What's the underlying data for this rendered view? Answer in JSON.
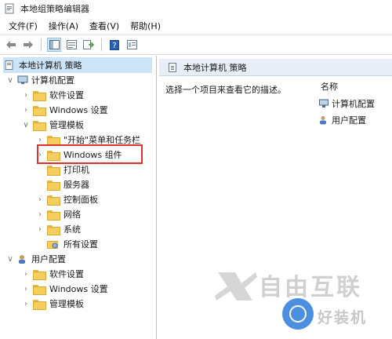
{
  "window": {
    "title": "本地组策略编辑器"
  },
  "menu": [
    "文件(F)",
    "操作(A)",
    "查看(V)",
    "帮助(H)"
  ],
  "toolbar": {
    "buttons": [
      "back-arrow-icon",
      "forward-arrow-icon",
      "tree-view-icon",
      "properties-icon",
      "export-icon",
      "help-icon",
      "details-view-icon"
    ]
  },
  "tree": {
    "root": "本地计算机 策略",
    "computer_config": "计算机配置",
    "cc_software": "软件设置",
    "cc_windows": "Windows 设置",
    "cc_admin": "管理模板",
    "cc_admin_start": "\"开始\"菜单和任务栏",
    "cc_admin_components": "Windows 组件",
    "cc_admin_printers": "打印机",
    "cc_admin_server": "服务器",
    "cc_admin_control": "控制面板",
    "cc_admin_network": "网络",
    "cc_admin_system": "系统",
    "cc_admin_all": "所有设置",
    "user_config": "用户配置",
    "uc_software": "软件设置",
    "uc_windows": "Windows 设置",
    "uc_admin": "管理模板"
  },
  "details": {
    "header": "本地计算机 策略",
    "description": "选择一个项目来查看它的描述。",
    "column_name": "名称",
    "items": [
      "计算机配置",
      "用户配置"
    ]
  },
  "watermark": {
    "main": "自由互联",
    "secondary": "好装机"
  },
  "colors": {
    "selection": "#cce4f7",
    "highlight_box": "#e0322d",
    "header_bg": "#e8eef6"
  }
}
